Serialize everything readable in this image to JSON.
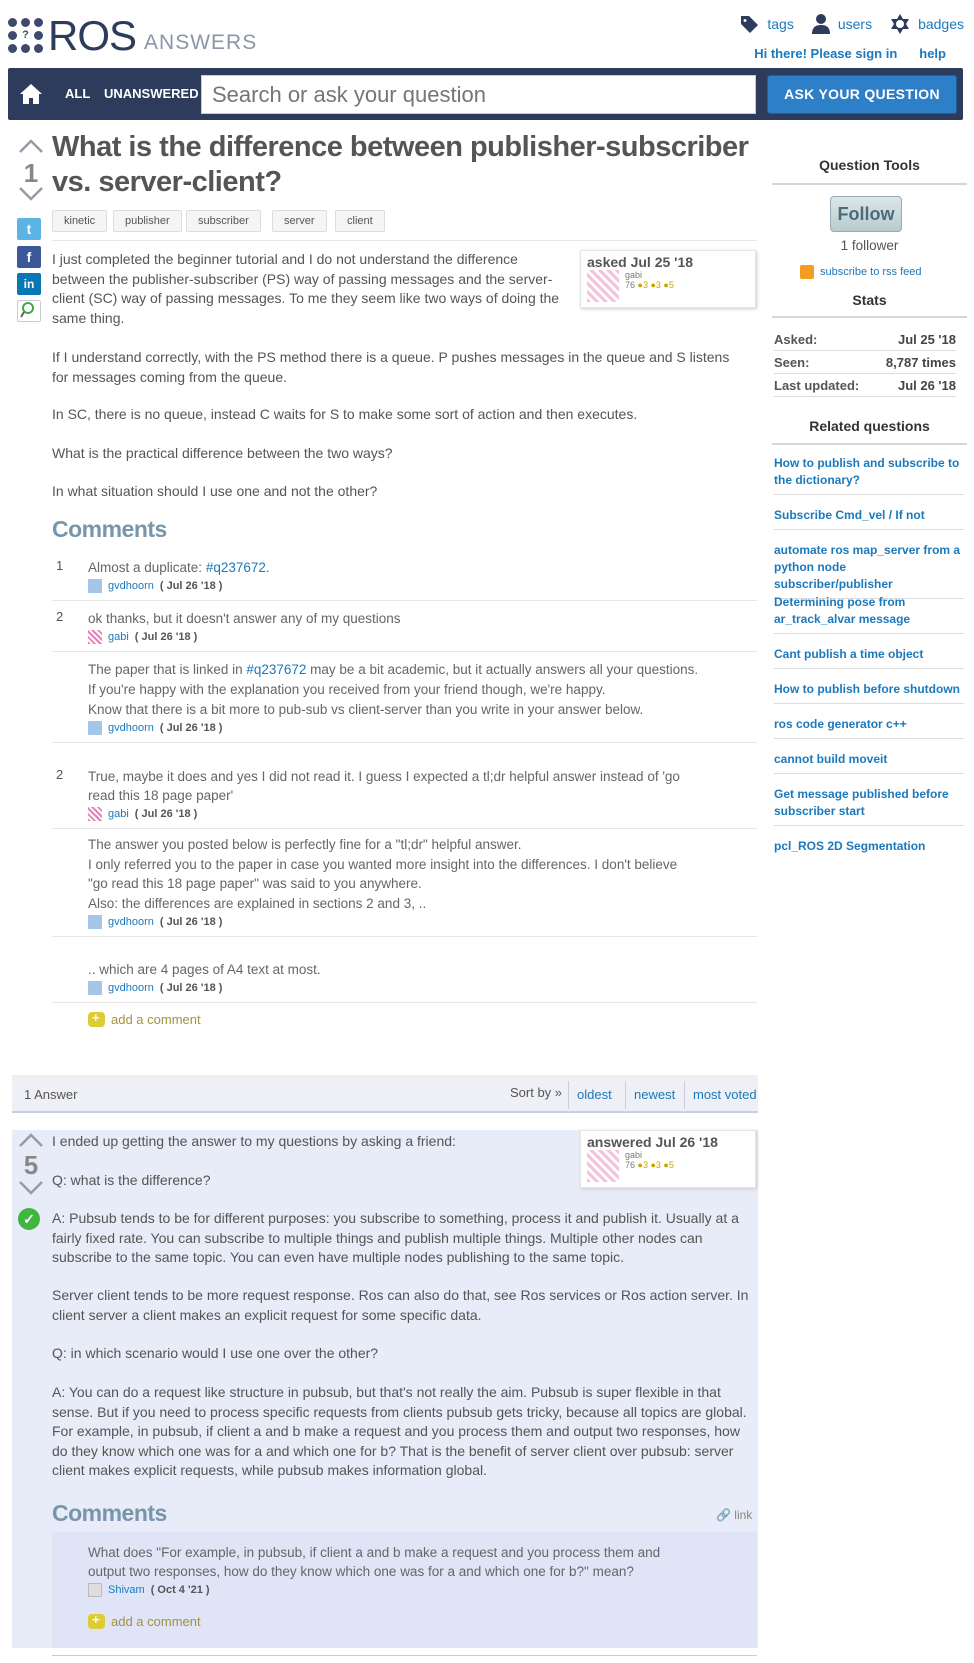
{
  "header": {
    "logo_main": "ROS",
    "logo_sub": "ANSWERS",
    "links": [
      "tags",
      "users",
      "badges"
    ],
    "signin": "Hi there! Please sign in",
    "help": "help"
  },
  "nav": {
    "all": "ALL",
    "unanswered": "UNANSWERED",
    "search_placeholder": "Search or ask your question",
    "ask": "ASK YOUR QUESTION"
  },
  "question": {
    "votes": "1",
    "title": "What is the difference between publisher-subscriber vs. server-client?",
    "tags": [
      "kinetic",
      "publisher",
      "subscriber",
      "server",
      "client"
    ],
    "asked": "asked Jul 25 '18",
    "user": "gabi",
    "rep": "76",
    "badges": "●3 ●3 ●5",
    "paragraphs": [
      "I just completed the beginner tutorial and I do not understand the difference between the publisher-subscriber (PS) way of passing messages and the server-client (SC) way of passing messages. To me they seem like two ways of doing the same thing.",
      "If I understand correctly, with the PS method there is a queue. P pushes messages in the queue and S listens for messages coming from the queue.",
      "In SC, there is no queue, instead C waits for S to make some sort of action and then executes.",
      "What is the practical difference between the two ways?",
      "In what situation should I use one and not the other?"
    ]
  },
  "comments_heading": "Comments",
  "comments": [
    {
      "num": "1",
      "text": "Almost a duplicate: ",
      "link": "#q237672",
      "after": ".",
      "user": "gvdhoorn",
      "date": "( Jul 26 '18 )"
    },
    {
      "num": "2",
      "text": "ok thanks, but it doesn't answer any of my questions",
      "user": "gabi",
      "date": "( Jul 26 '18 )"
    },
    {
      "num": "",
      "text1": "The paper that is linked in ",
      "link": "#q237672",
      "text2": " may be a bit academic, but it actually answers all your questions.",
      "text3": "If you're happy with the explanation you received from your friend though, we're happy.",
      "text4": "Know that there is a bit more to pub-sub vs client-server than you write in your answer below.",
      "user": "gvdhoorn",
      "date": "( Jul 26 '18 )"
    },
    {
      "num": "2",
      "text": "True, maybe it does and yes I did not read it. I guess I expected a tl;dr helpful answer instead of 'go read this 18 page paper'",
      "user": "gabi",
      "date": "( Jul 26 '18 )"
    },
    {
      "num": "",
      "text1": "The answer you posted below is perfectly fine for a \"tl;dr\" helpful answer.",
      "text2": "I only referred you to the paper in case you wanted more insight into the differences. I don't believe \"go read this 18 page paper\" was said to you anywhere.",
      "text3": "Also: the differences are explained in sections 2 and 3, ..",
      "user": "gvdhoorn",
      "date": "( Jul 26 '18 )"
    },
    {
      "num": "",
      "text": ".. which are 4 pages of A4 text at most.",
      "user": "gvdhoorn",
      "date": "( Jul 26 '18 )"
    }
  ],
  "add_comment": "add a comment",
  "answers": {
    "count_label": "1 Answer",
    "sort_by": "Sort by »",
    "sort": [
      "oldest",
      "newest",
      "most voted"
    ]
  },
  "answer": {
    "votes": "5",
    "answered": "answered Jul 26 '18",
    "user": "gabi",
    "rep": "76",
    "badges": "●3 ●3 ●5",
    "paragraphs": [
      "I ended up getting the answer to my questions by asking a friend:",
      "Q: what is the difference?",
      "A: Pubsub tends to be for different purposes: you subscribe to something, process it and publish it. Usually at a fairly fixed rate. You can subscribe to multiple things and publish multiple things. Multiple other nodes can subscribe to the same topic. You can even have multiple nodes publishing to the same topic.",
      "Server client tends to be more request response. Ros can also do that, see Ros services or Ros action server. In client server a client makes an explicit request for some specific data.",
      "Q: in which scenario would I use one over the other?",
      "A: You can do a request like structure in pubsub, but that's not really the aim. Pubsub is super flexible in that sense. But if you need to process specific requests from clients pubsub gets tricky, because all topics are global. For example, in pubsub, if client a and b make a request and you process them and output two responses, how do they know which one was for a and which one for b? That is the benefit of server client over pubsub: server client makes explicit requests, while pubsub makes information global."
    ],
    "link": "link",
    "comment": {
      "text": "What does \"For example, in pubsub, if client a and b make a request and you process them and output two responses, how do they know which one was for a and which one for b?\" mean?",
      "user": "Shivam",
      "date": "( Oct 4 '21 )"
    }
  },
  "sidebar": {
    "tools": "Question Tools",
    "follow": "Follow",
    "followers": "1 follower",
    "rss": "subscribe to rss feed",
    "stats": "Stats",
    "stat_rows": [
      {
        "k": "Asked:",
        "v": "Jul 25 '18"
      },
      {
        "k": "Seen:",
        "v": "8,787 times"
      },
      {
        "k": "Last updated:",
        "v": "Jul 26 '18"
      }
    ],
    "related_heading": "Related questions",
    "related": [
      "How to publish and subscribe to the dictionary?",
      "Subscribe Cmd_vel / If not",
      "automate ros map_server from a python node subscriber/publisher",
      "Determining pose from ar_track_alvar message",
      "Cant publish a time object",
      "How to publish before shutdown",
      "ros code generator c++",
      "cannot build moveit",
      "Get message published before subscriber start",
      "pcl_ROS 2D Segmentation"
    ]
  },
  "colors": {
    "nav": "#2d3b5c",
    "link": "#1b79bd",
    "ask_button": "#2d7fc7",
    "answer_bg": "#e8ebf8"
  }
}
